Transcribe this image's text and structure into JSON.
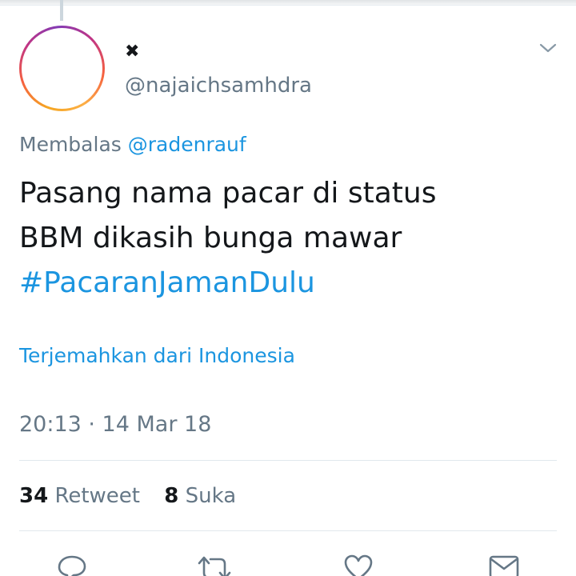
{
  "tweet": {
    "display_name": "✖",
    "handle": "@najaichsamhdra",
    "reply_prefix": "Membalas",
    "reply_mention": "@radenrauf",
    "text_line1": "Pasang nama pacar di status",
    "text_line2": "BBM dikasih bunga mawar",
    "hashtag": "#PacaranJamanDulu",
    "translate_label": "Terjemahkan dari Indonesia",
    "timestamp": "20:13 · 14 Mar 18"
  },
  "stats": {
    "retweet_count": "34",
    "retweet_label": "Retweet",
    "like_count": "8",
    "like_label": "Suka"
  },
  "icons": {
    "caret": "chevron-down-icon",
    "reply": "reply-icon",
    "retweet": "retweet-icon",
    "like": "heart-icon",
    "dm": "envelope-icon"
  },
  "colors": {
    "link": "#1b95e0",
    "secondary_text": "#657786",
    "primary_text": "#14171a",
    "divider": "#e1e8ed"
  }
}
